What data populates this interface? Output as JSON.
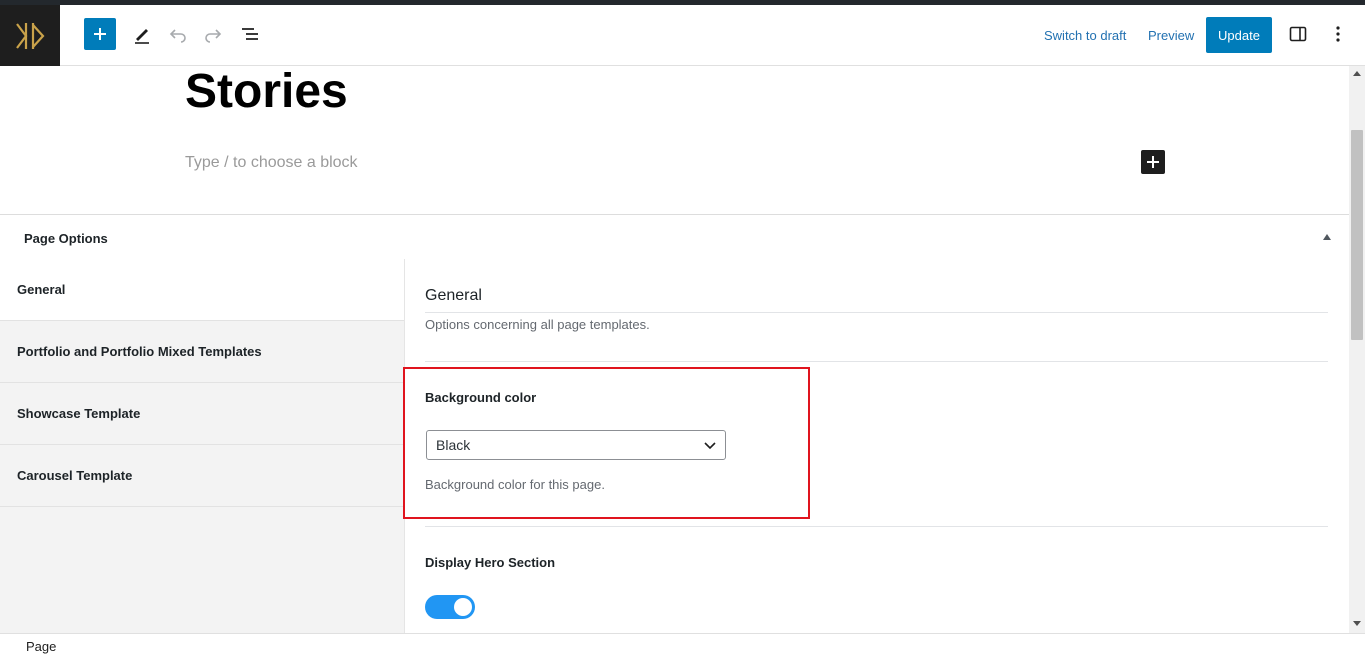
{
  "header": {
    "logo_icon": "site-logo-icon",
    "add_block_icon": "plus-icon",
    "tools_icon": "pencil-icon",
    "undo_icon": "undo-icon",
    "redo_icon": "redo-icon",
    "list_view_icon": "list-view-icon",
    "switch_to_draft": "Switch to draft",
    "preview": "Preview",
    "update": "Update",
    "settings_icon": "sidebar-toggle-icon",
    "more_icon": "more-vertical-icon",
    "accent_color": "#007cba"
  },
  "editor": {
    "post_title": "Stories",
    "block_placeholder": "Type / to choose a block"
  },
  "page_options": {
    "title": "Page Options",
    "tabs": [
      {
        "label": "General"
      },
      {
        "label": "Portfolio and Portfolio Mixed Templates"
      },
      {
        "label": "Showcase Template"
      },
      {
        "label": "Carousel Template"
      }
    ],
    "panel": {
      "title": "General",
      "description": "Options concerning all page templates.",
      "background_color": {
        "label": "Background color",
        "selected": "Black",
        "help": "Background color for this page."
      },
      "display_hero": {
        "label": "Display Hero Section",
        "enabled": true
      }
    },
    "highlight_color": "#e0141e"
  },
  "footer": {
    "breadcrumb": "Page"
  }
}
